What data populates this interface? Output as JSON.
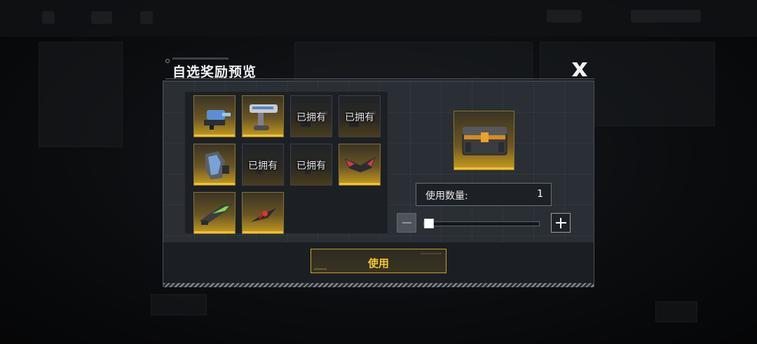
{
  "dialog": {
    "title": "自选奖励预览",
    "close_icon": "close-x-icon"
  },
  "rewards": [
    {
      "icon": "blue-turret-icon",
      "state": "available",
      "owned_label": ""
    },
    {
      "icon": "mech-arm-cannon-icon",
      "state": "available",
      "owned_label": ""
    },
    {
      "icon": "dark-cannon-icon",
      "state": "owned",
      "owned_label": "已拥有"
    },
    {
      "icon": "dark-cannon-icon",
      "state": "owned",
      "owned_label": "已拥有"
    },
    {
      "icon": "blue-armor-plate-icon",
      "state": "available",
      "owned_label": ""
    },
    {
      "icon": "dark-rifle-icon",
      "state": "owned",
      "owned_label": "已拥有"
    },
    {
      "icon": "dark-rifle-icon",
      "state": "owned",
      "owned_label": "已拥有"
    },
    {
      "icon": "red-wing-icon",
      "state": "available",
      "owned_label": ""
    },
    {
      "icon": "green-blade-icon",
      "state": "available",
      "owned_label": ""
    },
    {
      "icon": "red-drone-icon",
      "state": "available",
      "owned_label": ""
    }
  ],
  "selected_item": {
    "icon": "supply-chest-icon"
  },
  "quantity": {
    "label": "使用数量:",
    "value": "1",
    "slider_fraction": 0.0,
    "minus_icon": "minus-icon",
    "plus_icon": "plus-icon"
  },
  "use_button": {
    "label": "使用"
  },
  "colors": {
    "accent": "#f2c12e",
    "panel": "#2a2f36",
    "owned_text": "#e6e6e6"
  }
}
